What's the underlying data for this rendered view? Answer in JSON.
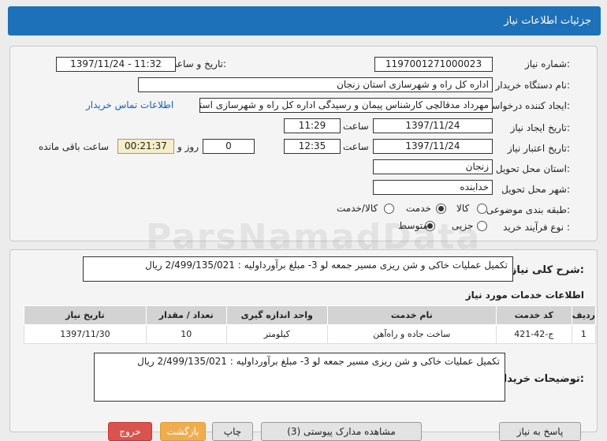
{
  "title": "جزئیات اطلاعات نیاز",
  "labels": {
    "need_number": "شماره نیاز:",
    "announce_datetime": "تاریخ و ساعت اعلان عمومی:",
    "buyer_org": "نام دستگاه خریدار:",
    "requester": "ایجاد کننده درخواست:",
    "contact_link": "اطلاعات تماس خریدار",
    "created_date": "تاریخ ایجاد نیاز:",
    "time": "ساعت",
    "validity_date": "تاریخ اعتبار نیاز:",
    "day_and": "روز و",
    "remaining": "ساعت باقی مانده",
    "province": "استان محل تحویل:",
    "city": "شهر محل تحویل:",
    "category": "طبقه بندی موضوعی:",
    "cat_goods": "کالا",
    "cat_service": "خدمت",
    "cat_goods_service": "کالا/خدمت",
    "process_type": "نوع فرآیند خرید :",
    "proc_minor": "جزیی",
    "proc_medium": "متوسط",
    "summary": "شرح کلی نیاز:",
    "services_info": "اطلاعات خدمات مورد نیاز",
    "buyer_notes": "توضیحات خریدار:"
  },
  "values": {
    "need_number": "1197001271000023",
    "announce_datetime": "1397/11/24 - 11:32",
    "buyer_org": "اداره کل راه و شهرسازی استان زنجان",
    "requester": "مهرداد مدقالچی کارشناس پیمان و رسیدگی اداره کل راه و شهرسازی استان زنجان",
    "created_date": "1397/11/24",
    "created_time": "11:29",
    "validity_date": "1397/11/24",
    "validity_time": "12:35",
    "days": "0",
    "remaining_time": "00:21:37",
    "province": "زنجان",
    "city": "خدابنده",
    "category_selected": "خدمت",
    "process_selected": "متوسط",
    "summary": "تکمیل عملیات خاکی و شن ریزی مسیر جمعه لو 3- مبلغ برآورداولیه : 2/499/135/021  ریال",
    "buyer_notes": "تکمیل عملیات خاکی و شن ریزی مسیر جمعه لو 3- مبلغ برآورداولیه : 2/499/135/021  ریال"
  },
  "table": {
    "headers": [
      "ردیف",
      "کد خدمت",
      "نام خدمت",
      "واحد اندازه گیری",
      "تعداد / مقدار",
      "تاریخ نیاز"
    ],
    "rows": [
      [
        "1",
        "ج-42-421",
        "ساخت جاده و راه‌آهن",
        "کیلومتر",
        "10",
        "1397/11/30"
      ]
    ]
  },
  "buttons": {
    "reply": "پاسخ به نیاز",
    "view_docs": "مشاهده مدارک پیوستی (3)",
    "print": "چاپ",
    "back": "بازگشت",
    "exit": "خروج"
  },
  "watermark": "ParsNamadData",
  "colors": {
    "header": "#1d71b8",
    "link": "#1560bd",
    "exit": "#d9534f",
    "back": "#f0ad4e"
  }
}
